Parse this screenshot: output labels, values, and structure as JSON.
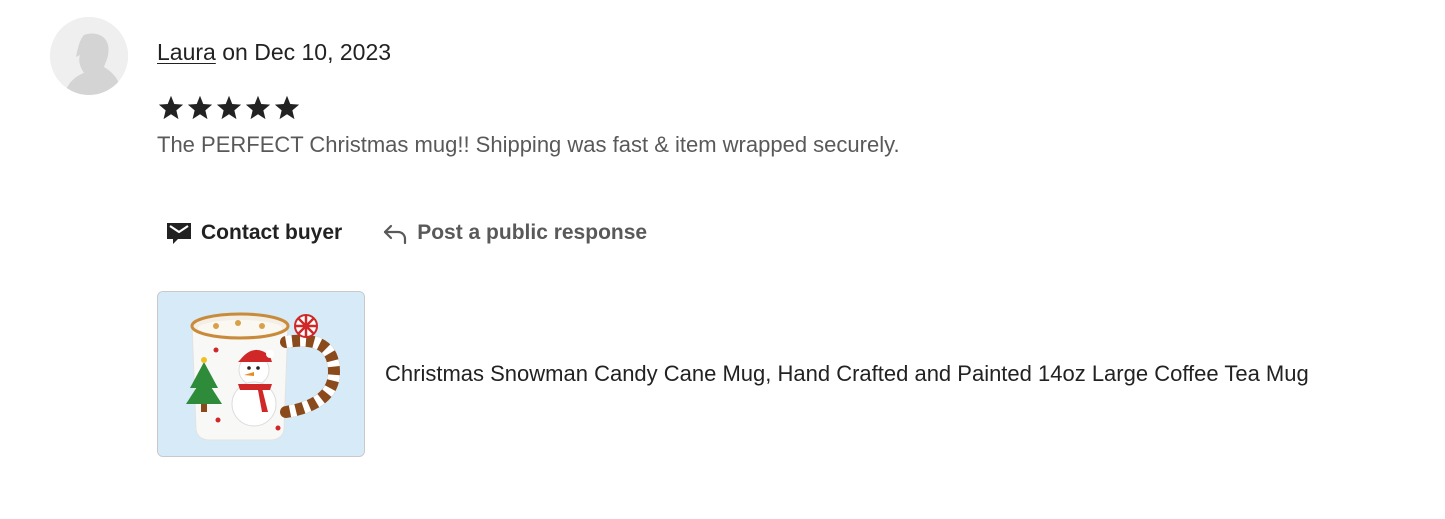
{
  "review": {
    "author": "Laura",
    "date_prefix": " on ",
    "date": "Dec 10, 2023",
    "rating": 5,
    "rating_max": 5,
    "text": "The PERFECT Christmas mug!! Shipping was fast & item wrapped securely."
  },
  "actions": {
    "contact_label": "Contact buyer",
    "respond_label": "Post a public response",
    "contact_icon": "envelope-icon",
    "respond_icon": "reply-arrow-icon"
  },
  "listing": {
    "title": "Christmas Snowman Candy Cane Mug, Hand Crafted and Painted 14oz Large Coffee Tea Mug",
    "image_desc_icon": "snowman-mug-image"
  },
  "colors": {
    "text_primary": "#222222",
    "text_secondary": "#595959",
    "star": "#222222",
    "thumb_bg": "#d6eaf8"
  }
}
